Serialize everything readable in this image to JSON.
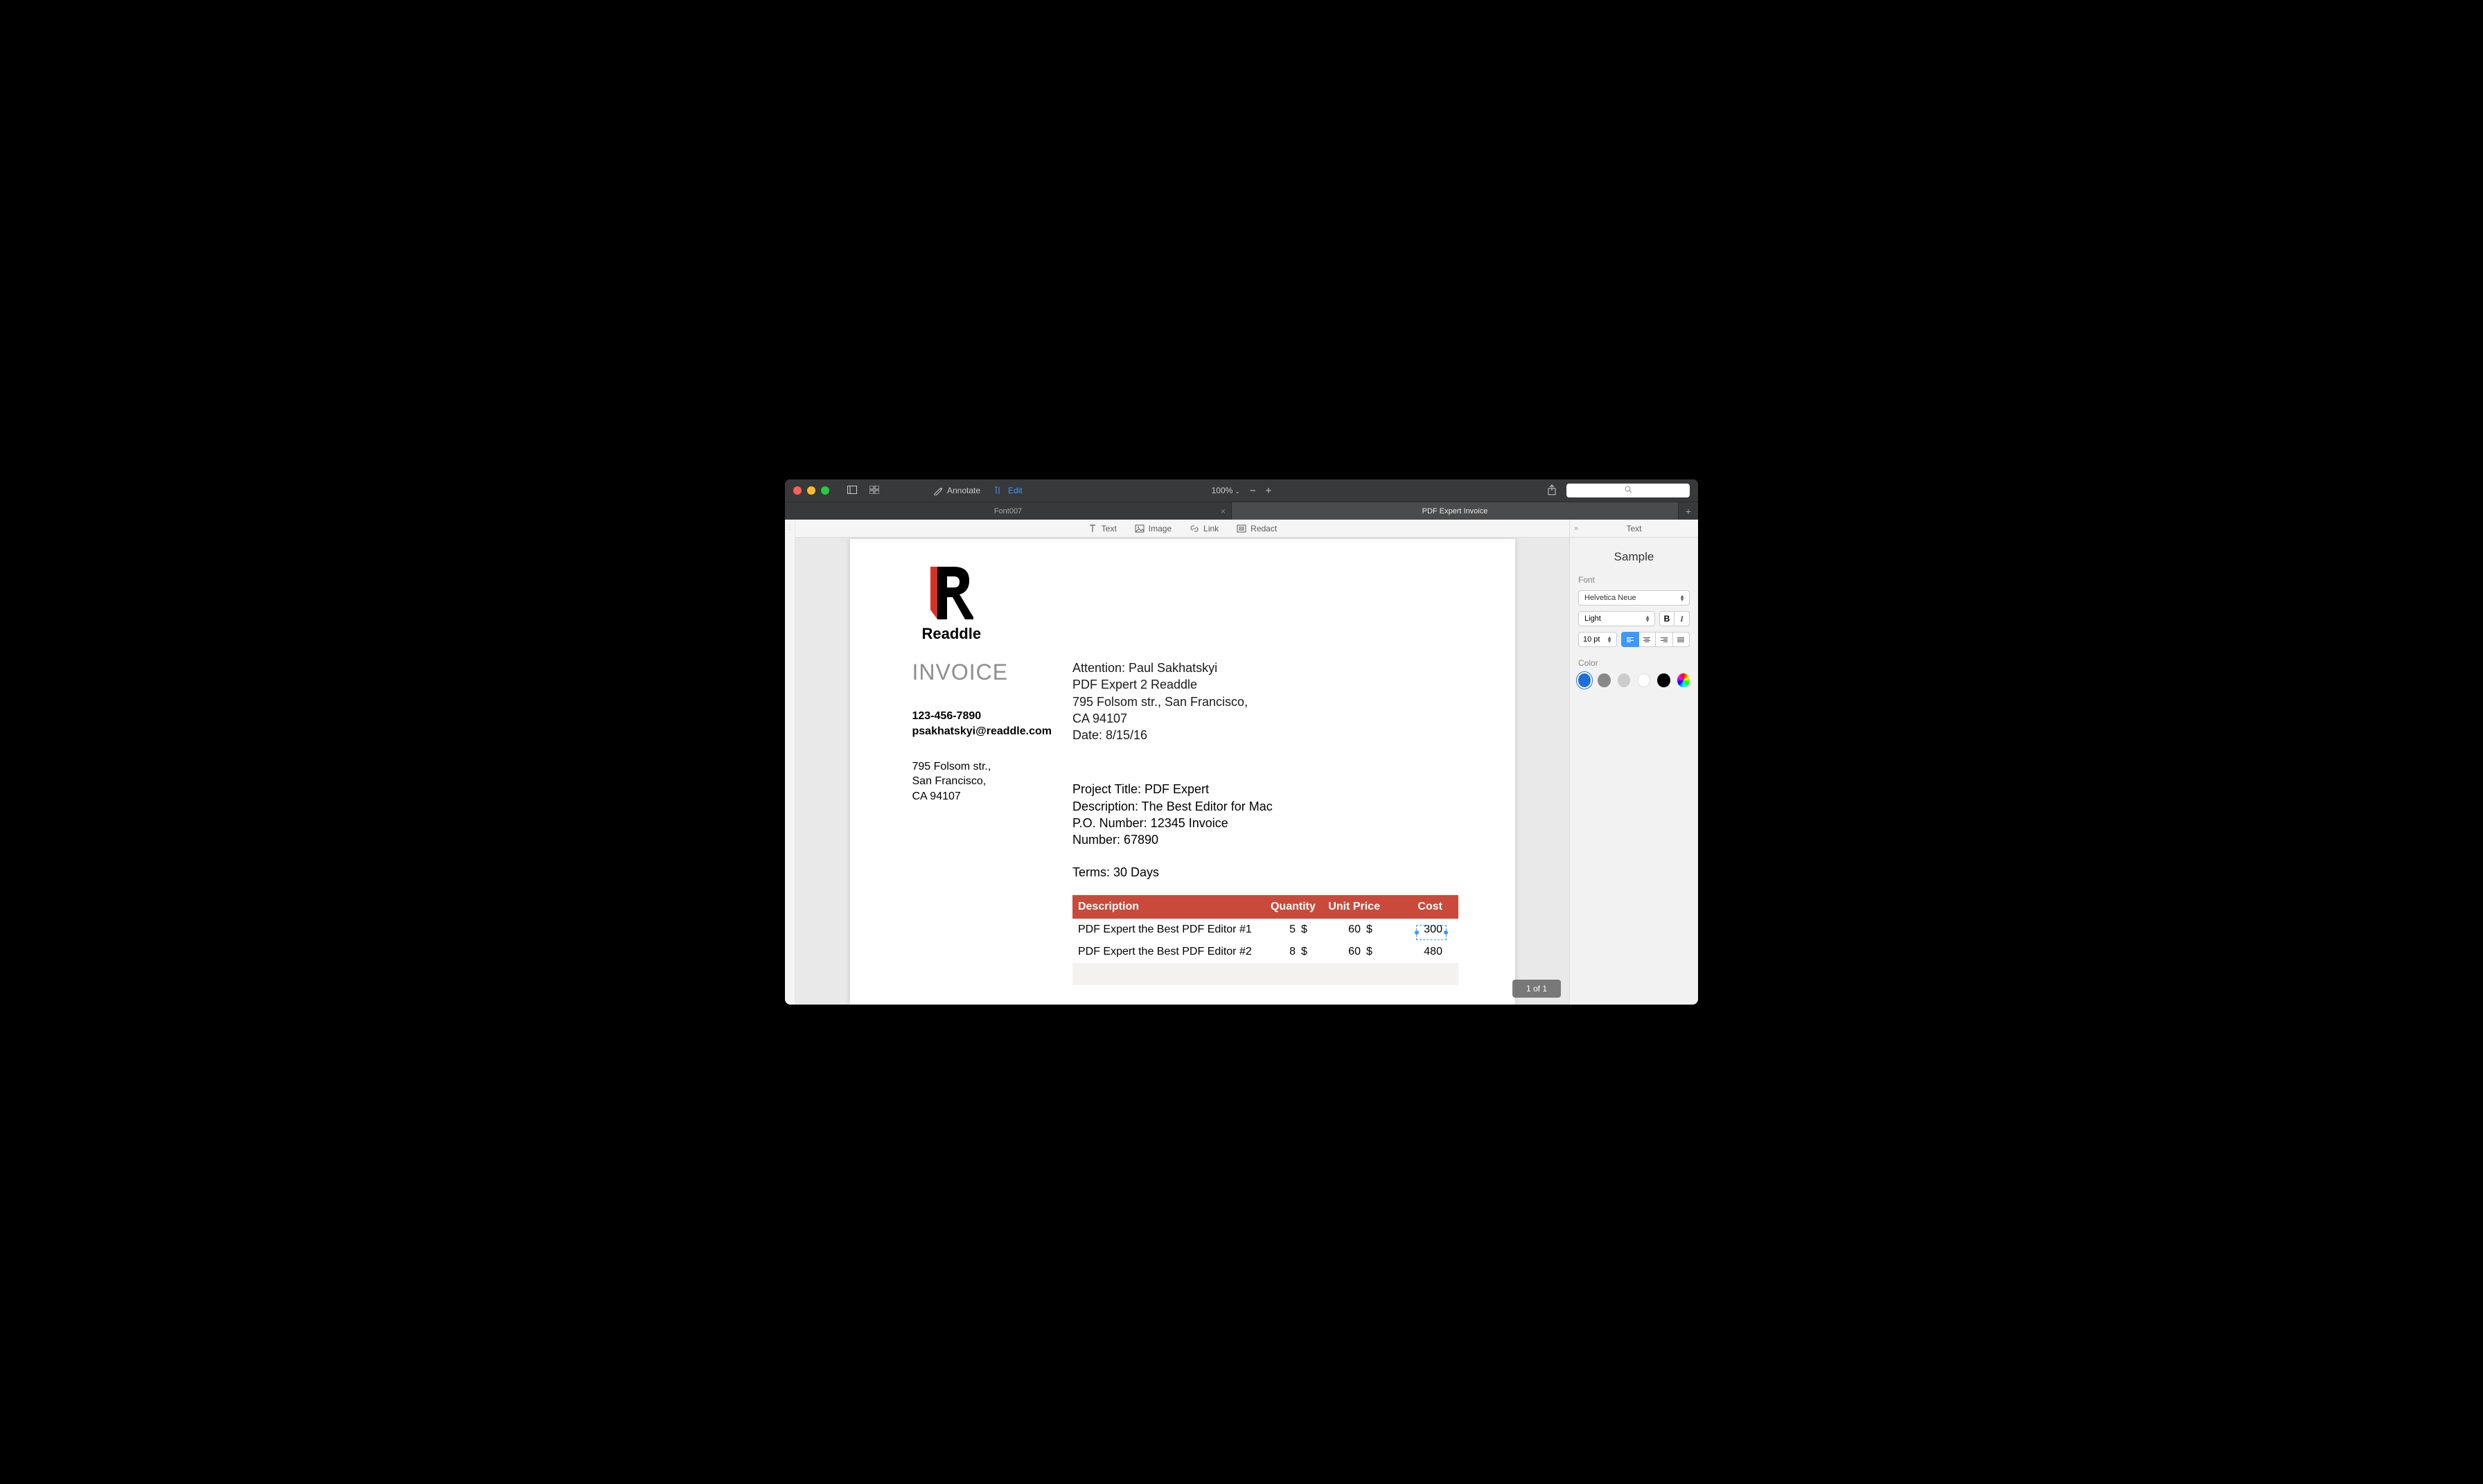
{
  "toolbar": {
    "annotate": "Annotate",
    "edit": "Edit",
    "zoom": "100%"
  },
  "tabs": {
    "tab1": "Font007",
    "tab2": "PDF Expert Invoice"
  },
  "edit_tools": {
    "text": "Text",
    "image": "Image",
    "link": "Link",
    "redact": "Redact"
  },
  "sidebar": {
    "title": "Text",
    "sample": "Sample",
    "font_label": "Font",
    "font_family": "Helvetica Neue",
    "font_weight": "Light",
    "font_size": "10 pt",
    "bold": "B",
    "italic": "I",
    "color_label": "Color"
  },
  "page_indicator": "1 of 1",
  "doc": {
    "company": "Readdle",
    "title": "INVOICE",
    "phone": "123-456-7890",
    "email": "psakhatskyi@readdle.com",
    "addr1": "795 Folsom str.,",
    "addr2": "San Francisco,",
    "addr3": "CA 94107",
    "attn": "Attention: Paul Sakhatskyi",
    "attn2": "PDF Expert 2 Readdle",
    "attn3": "795 Folsom str., San Francisco,",
    "attn4": "CA 94107",
    "date": "Date: 8/15/16",
    "proj1": "Project Title: PDF Expert",
    "proj2": "Description: The Best Editor for Mac",
    "proj3": "P.O. Number: 12345 Invoice",
    "proj4": "Number: 67890",
    "terms": "Terms: 30 Days",
    "table": {
      "h1": "Description",
      "h2": "Quantity",
      "h3": "Unit Price",
      "h4": "Cost",
      "currency": "$",
      "rows": [
        {
          "desc": "PDF Expert the Best PDF Editor #1",
          "qty": "5",
          "unit": "60",
          "cost": "300"
        },
        {
          "desc": "PDF Expert the Best PDF Editor #2",
          "qty": "8",
          "unit": "60",
          "cost": "480"
        }
      ]
    }
  }
}
